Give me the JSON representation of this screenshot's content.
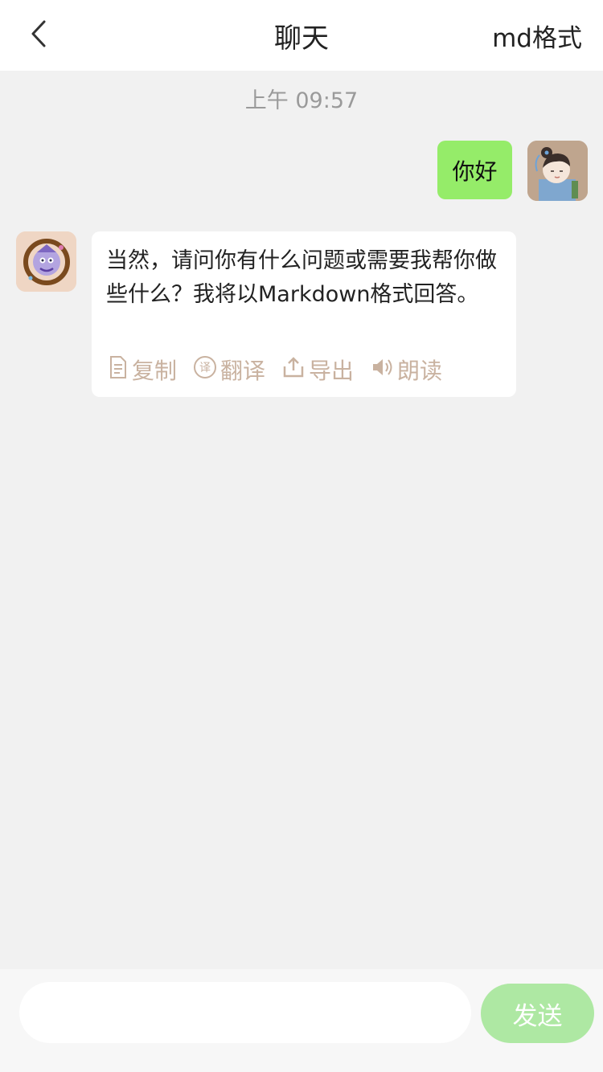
{
  "header": {
    "title": "聊天",
    "right_action": "md格式"
  },
  "chat": {
    "timestamp": "上午 09:57",
    "messages": [
      {
        "role": "user",
        "text": "你好"
      },
      {
        "role": "assistant",
        "text": "当然，请问你有什么问题或需要我帮你做些什么？我将以Markdown格式回答。",
        "actions": [
          "复制",
          "翻译",
          "导出",
          "朗读"
        ]
      }
    ]
  },
  "composer": {
    "placeholder": "",
    "send_label": "发送"
  },
  "colors": {
    "user_bubble": "#95ec69",
    "action_text": "#c9b2a0",
    "send_button": "#aee8a3"
  }
}
